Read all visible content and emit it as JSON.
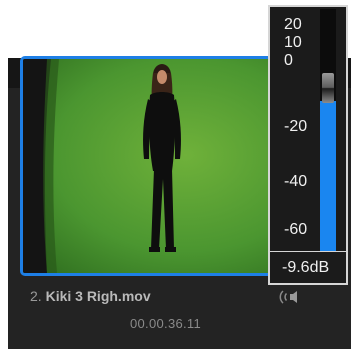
{
  "clip": {
    "index": "2.",
    "name": "Kiki 3 Righ.mov",
    "timecode": "00.00.36.11",
    "audio_icon": "speaker-icon"
  },
  "volume_meter": {
    "scale": [
      "20",
      "10",
      "0",
      "-20",
      "-40",
      "-60"
    ],
    "value_label": "-9.6dB",
    "value_db": -9.6,
    "level_fraction": 0.62,
    "accent": "#1a86f0"
  },
  "colors": {
    "selection_border": "#1e7fe6",
    "green_screen": "#3f8f2a"
  }
}
